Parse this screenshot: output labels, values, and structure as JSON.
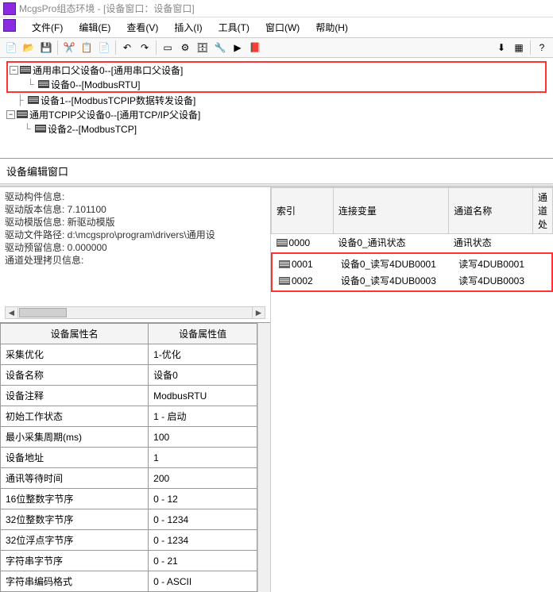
{
  "title": "McgsPro组态环境 - [设备窗口：设备窗口]",
  "menus": [
    "文件(F)",
    "编辑(E)",
    "查看(V)",
    "插入(I)",
    "工具(T)",
    "窗口(W)",
    "帮助(H)"
  ],
  "tree": {
    "n0": "通用串口父设备0--[通用串口父设备]",
    "n0_0": "设备0--[ModbusRTU]",
    "n1": "设备1--[ModbusTCPIP数据转发设备]",
    "n2": "通用TCPIP父设备0--[通用TCP/IP父设备]",
    "n2_0": "设备2--[ModbusTCP]"
  },
  "editor_title": "设备编辑窗口",
  "info": {
    "l0": "驱动构件信息:",
    "l1": "驱动版本信息: 7.101100",
    "l2": "驱动模版信息: 新驱动模版",
    "l3": "驱动文件路径: d:\\mcgspro\\program\\drivers\\通用设",
    "l4": "驱动预留信息: 0.000000",
    "l5": "通道处理拷贝信息:"
  },
  "prop_headers": {
    "name": "设备属性名",
    "value": "设备属性值"
  },
  "props": [
    {
      "n": "采集优化",
      "v": "1-优化"
    },
    {
      "n": "设备名称",
      "v": "设备0"
    },
    {
      "n": "设备注释",
      "v": "ModbusRTU"
    },
    {
      "n": "初始工作状态",
      "v": "1 - 启动"
    },
    {
      "n": "最小采集周期(ms)",
      "v": "100"
    },
    {
      "n": "设备地址",
      "v": "1"
    },
    {
      "n": "通讯等待时间",
      "v": "200"
    },
    {
      "n": "16位整数字节序",
      "v": "0 - 12"
    },
    {
      "n": "32位整数字节序",
      "v": "0 - 1234"
    },
    {
      "n": "32位浮点字节序",
      "v": "0 - 1234"
    },
    {
      "n": "字符串字节序",
      "v": "0 - 21"
    },
    {
      "n": "字符串编码格式",
      "v": "0 - ASCII"
    }
  ],
  "chan_headers": {
    "idx": "索引",
    "var": "连接变量",
    "name": "通道名称",
    "proc": "通道处"
  },
  "channels": [
    {
      "idx": "0000",
      "var": "设备0_通讯状态",
      "name": "通讯状态"
    },
    {
      "idx": "0001",
      "var": "设备0_读写4DUB0001",
      "name": "读写4DUB0001"
    },
    {
      "idx": "0002",
      "var": "设备0_读写4DUB0003",
      "name": "读写4DUB0003"
    }
  ]
}
